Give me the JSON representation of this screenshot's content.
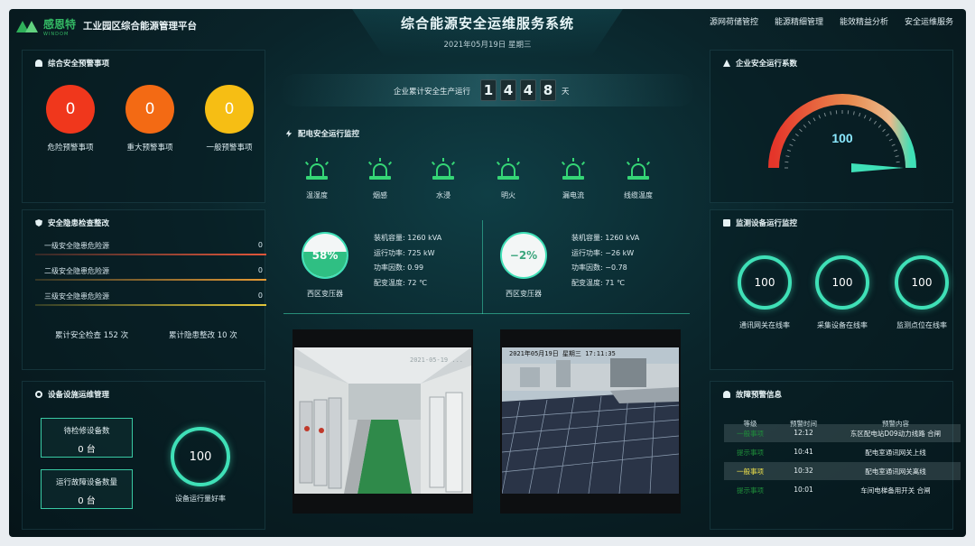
{
  "header": {
    "brand_name": "感恩特",
    "brand_sub": "WINDOM",
    "platform": "工业园区综合能源管理平台",
    "title": "综合能源安全运维服务系统",
    "date": "2021年05月19日 星期三",
    "nav": [
      "源网荷储管控",
      "能源精细管理",
      "能效精益分析",
      "安全运维服务"
    ]
  },
  "warnings": {
    "title": "综合安全预警事项",
    "items": [
      {
        "label": "危险预警事项",
        "value": "0",
        "color": "#f0371c"
      },
      {
        "label": "重大预警事项",
        "value": "0",
        "color": "#f36a14"
      },
      {
        "label": "一般预警事项",
        "value": "0",
        "color": "#f6be14"
      }
    ]
  },
  "hazards": {
    "title": "安全隐患检查整改",
    "rows": [
      {
        "label": "一级安全隐患危险源",
        "value": "0",
        "color": "#e2563a"
      },
      {
        "label": "二级安全隐患危险源",
        "value": "0",
        "color": "#e79a34"
      },
      {
        "label": "三级安全隐患危险源",
        "value": "0",
        "color": "#e2c53a"
      }
    ],
    "total_check": "累计安全检查 152 次",
    "total_fix": "累计隐患整改 10 次"
  },
  "facility": {
    "title": "设备设施运维管理",
    "pending_label": "待检修设备数",
    "pending_value": "0 台",
    "fault_label": "运行故障设备数量",
    "fault_value": "0 台",
    "rate_value": "100",
    "rate_label": "设备运行量好率"
  },
  "counter": {
    "label": "企业累计安全生产运行",
    "digits": [
      "1",
      "4",
      "4",
      "8"
    ],
    "unit": "天"
  },
  "power": {
    "title": "配电安全运行监控",
    "alarms": [
      "温湿度",
      "烟感",
      "水浸",
      "明火",
      "漏电流",
      "线缆温度"
    ],
    "transformers": [
      {
        "name": "西区变压器",
        "percent_text": "58%",
        "fill": 0.58,
        "rows": [
          "装机容量:   1260 kVA",
          "运行功率:   725 kW",
          "功率因数:   0.99",
          "配变温度:   72 ℃"
        ]
      },
      {
        "name": "西区变压器",
        "percent_text": "−2%",
        "fill": 0.0,
        "rows": [
          "装机容量:   1260 kVA",
          "运行功率:   −26 kW",
          "功率因数:   −0.78",
          "配变温度:   71 ℃"
        ]
      }
    ]
  },
  "cameras": [
    {
      "timestamp": "2021-05-19 ..."
    },
    {
      "timestamp": "2021年05月19日 星期三 17:11:35"
    }
  ],
  "safety_index": {
    "title": "企业安全运行系数",
    "value": "100",
    "level": 1.0
  },
  "monitoring": {
    "title": "监测设备运行监控",
    "items": [
      {
        "value": "100",
        "label": "通讯网关在线率"
      },
      {
        "value": "100",
        "label": "采集设备在线率"
      },
      {
        "value": "100",
        "label": "监测点位在线率"
      }
    ]
  },
  "faults": {
    "title": "故障预警信息",
    "headers": [
      "等级",
      "预警时间",
      "预警内容"
    ],
    "rows": [
      {
        "level": "一般事项",
        "time": "12:12",
        "content": "东区配电站D09动力线路 合闸",
        "level_color": "#1f8f3a"
      },
      {
        "level": "提示事项",
        "time": "10:41",
        "content": "配电室通讯网关上线",
        "level_color": "#1f8f3a"
      },
      {
        "level": "一般事项",
        "time": "10:32",
        "content": "配电室通讯网关离线",
        "level_color": "#f0e24a"
      },
      {
        "level": "提示事项",
        "time": "10:01",
        "content": "车间电梯备用开关 合闸",
        "level_color": "#1f8f3a"
      }
    ]
  },
  "colors": {
    "accent": "#3fe0b7",
    "alarm_green": "#35d676"
  }
}
